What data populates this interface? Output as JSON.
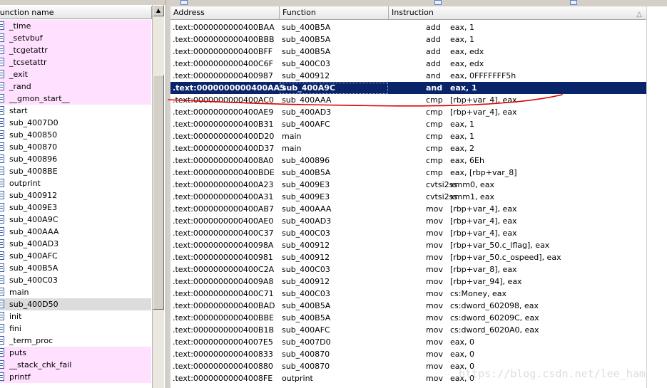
{
  "functions_pane": {
    "header": "Function name",
    "items": [
      {
        "name": "_time",
        "lib": true
      },
      {
        "name": "_setvbuf",
        "lib": true
      },
      {
        "name": "_tcgetattr",
        "lib": true
      },
      {
        "name": "_tcsetattr",
        "lib": true
      },
      {
        "name": "_exit",
        "lib": true
      },
      {
        "name": "_rand",
        "lib": true
      },
      {
        "name": "__gmon_start__",
        "lib": true
      },
      {
        "name": "start",
        "lib": false
      },
      {
        "name": "sub_4007D0",
        "lib": false
      },
      {
        "name": "sub_400850",
        "lib": false
      },
      {
        "name": "sub_400870",
        "lib": false
      },
      {
        "name": "sub_400896",
        "lib": false
      },
      {
        "name": "sub_4008BE",
        "lib": false
      },
      {
        "name": "outprint",
        "lib": false
      },
      {
        "name": "sub_400912",
        "lib": false
      },
      {
        "name": "sub_4009E3",
        "lib": false
      },
      {
        "name": "sub_400A9C",
        "lib": false
      },
      {
        "name": "sub_400AAA",
        "lib": false
      },
      {
        "name": "sub_400AD3",
        "lib": false
      },
      {
        "name": "sub_400AFC",
        "lib": false
      },
      {
        "name": "sub_400B5A",
        "lib": false
      },
      {
        "name": "sub_400C03",
        "lib": false
      },
      {
        "name": "main",
        "lib": false
      },
      {
        "name": "sub_400D50",
        "lib": false,
        "selected": true
      },
      {
        "name": "init",
        "lib": false
      },
      {
        "name": "fini",
        "lib": false
      },
      {
        "name": "_term_proc",
        "lib": false
      },
      {
        "name": "puts",
        "lib": true
      },
      {
        "name": "__stack_chk_fail",
        "lib": true
      },
      {
        "name": "printf",
        "lib": true
      }
    ]
  },
  "xrefs_pane": {
    "columns": {
      "address": "Address",
      "function": "Function",
      "instruction": "Instruction"
    },
    "rows": [
      {
        "address": ".text:0000000000400BAA",
        "function": "sub_400B5A",
        "mnemonic": "add",
        "operands": "eax, 1"
      },
      {
        "address": ".text:0000000000400BBB",
        "function": "sub_400B5A",
        "mnemonic": "add",
        "operands": "eax, 1"
      },
      {
        "address": ".text:0000000000400BFF",
        "function": "sub_400B5A",
        "mnemonic": "add",
        "operands": "eax, edx"
      },
      {
        "address": ".text:0000000000400C6F",
        "function": "sub_400C03",
        "mnemonic": "add",
        "operands": "eax, edx"
      },
      {
        "address": ".text:0000000000400987",
        "function": "sub_400912",
        "mnemonic": "and",
        "operands": "eax, 0FFFFFFF5h"
      },
      {
        "address": ".text:0000000000400AA5",
        "function": "sub_400A9C",
        "mnemonic": "and",
        "operands": "eax, 1",
        "selected": true
      },
      {
        "address": ".text:0000000000400AC0",
        "function": "sub_400AAA",
        "mnemonic": "cmp",
        "operands": "[rbp+var_4], eax"
      },
      {
        "address": ".text:0000000000400AE9",
        "function": "sub_400AD3",
        "mnemonic": "cmp",
        "operands": "[rbp+var_4], eax"
      },
      {
        "address": ".text:0000000000400B31",
        "function": "sub_400AFC",
        "mnemonic": "cmp",
        "operands": "eax, 1"
      },
      {
        "address": ".text:0000000000400D20",
        "function": "main",
        "mnemonic": "cmp",
        "operands": "eax, 1"
      },
      {
        "address": ".text:0000000000400D37",
        "function": "main",
        "mnemonic": "cmp",
        "operands": "eax, 2"
      },
      {
        "address": ".text:00000000004008A0",
        "function": "sub_400896",
        "mnemonic": "cmp",
        "operands": "eax, 6Eh"
      },
      {
        "address": ".text:0000000000400BDE",
        "function": "sub_400B5A",
        "mnemonic": "cmp",
        "operands": "eax, [rbp+var_8]"
      },
      {
        "address": ".text:0000000000400A23",
        "function": "sub_4009E3",
        "mnemonic": "cvtsi2ss",
        "operands": "xmm0, eax"
      },
      {
        "address": ".text:0000000000400A31",
        "function": "sub_4009E3",
        "mnemonic": "cvtsi2ss",
        "operands": "xmm1, eax"
      },
      {
        "address": ".text:0000000000400AB7",
        "function": "sub_400AAA",
        "mnemonic": "mov",
        "operands": "[rbp+var_4], eax"
      },
      {
        "address": ".text:0000000000400AE0",
        "function": "sub_400AD3",
        "mnemonic": "mov",
        "operands": "[rbp+var_4], eax"
      },
      {
        "address": ".text:0000000000400C37",
        "function": "sub_400C03",
        "mnemonic": "mov",
        "operands": "[rbp+var_4], eax"
      },
      {
        "address": ".text:000000000040098A",
        "function": "sub_400912",
        "mnemonic": "mov",
        "operands": "[rbp+var_50.c_lflag], eax"
      },
      {
        "address": ".text:0000000000400981",
        "function": "sub_400912",
        "mnemonic": "mov",
        "operands": "[rbp+var_50.c_ospeed], eax"
      },
      {
        "address": ".text:0000000000400C2A",
        "function": "sub_400C03",
        "mnemonic": "mov",
        "operands": "[rbp+var_8], eax"
      },
      {
        "address": ".text:00000000004009A8",
        "function": "sub_400912",
        "mnemonic": "mov",
        "operands": "[rbp+var_94], eax"
      },
      {
        "address": ".text:0000000000400C71",
        "function": "sub_400C03",
        "mnemonic": "mov",
        "operands": "cs:Money, eax"
      },
      {
        "address": ".text:0000000000400BAD",
        "function": "sub_400B5A",
        "mnemonic": "mov",
        "operands": "cs:dword_602098, eax"
      },
      {
        "address": ".text:0000000000400BBE",
        "function": "sub_400B5A",
        "mnemonic": "mov",
        "operands": "cs:dword_60209C, eax"
      },
      {
        "address": ".text:0000000000400B1B",
        "function": "sub_400AFC",
        "mnemonic": "mov",
        "operands": "cs:dword_6020A0, eax"
      },
      {
        "address": ".text:00000000004007E5",
        "function": "sub_4007D0",
        "mnemonic": "mov",
        "operands": "eax, 0"
      },
      {
        "address": ".text:0000000000400833",
        "function": "sub_400870",
        "mnemonic": "mov",
        "operands": "eax, 0"
      },
      {
        "address": ".text:0000000000400880",
        "function": "sub_400870",
        "mnemonic": "mov",
        "operands": "eax, 0"
      },
      {
        "address": ".text:00000000004008FE",
        "function": "outprint",
        "mnemonic": "mov",
        "operands": "eax, 0"
      }
    ]
  },
  "watermark": "https://blog.csdn.net/lee_ham",
  "colors": {
    "selection": "#0a246a",
    "library_row": "#ffe0ff",
    "annotation": "#e00000"
  }
}
